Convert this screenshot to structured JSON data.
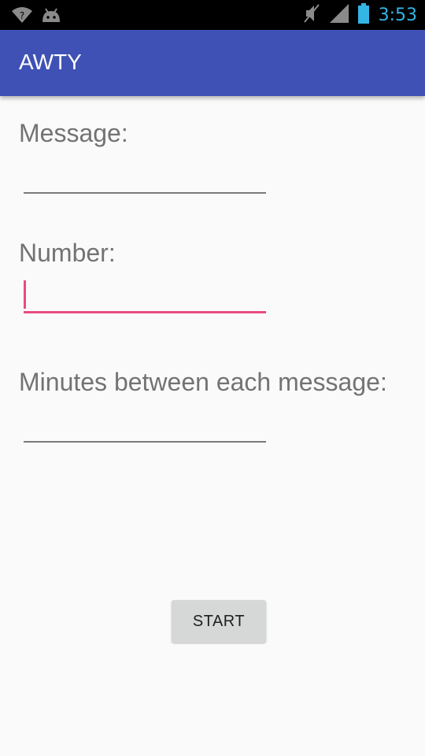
{
  "status_bar": {
    "time": "3:53",
    "time_color": "#33b5e5",
    "icons_left": [
      "wifi-question-icon",
      "android-debug-icon"
    ],
    "icons_right": [
      "mute-icon",
      "signal-icon",
      "battery-icon"
    ]
  },
  "app_bar": {
    "title": "AWTY",
    "color": "#3f51b5"
  },
  "form": {
    "message_label": "Message:",
    "message_value": "",
    "number_label": "Number:",
    "number_value": "",
    "minutes_label": "Minutes between each message:",
    "minutes_value": "",
    "focused_field": "number",
    "accent_color": "#e84b83"
  },
  "start_button": {
    "label": "START"
  }
}
